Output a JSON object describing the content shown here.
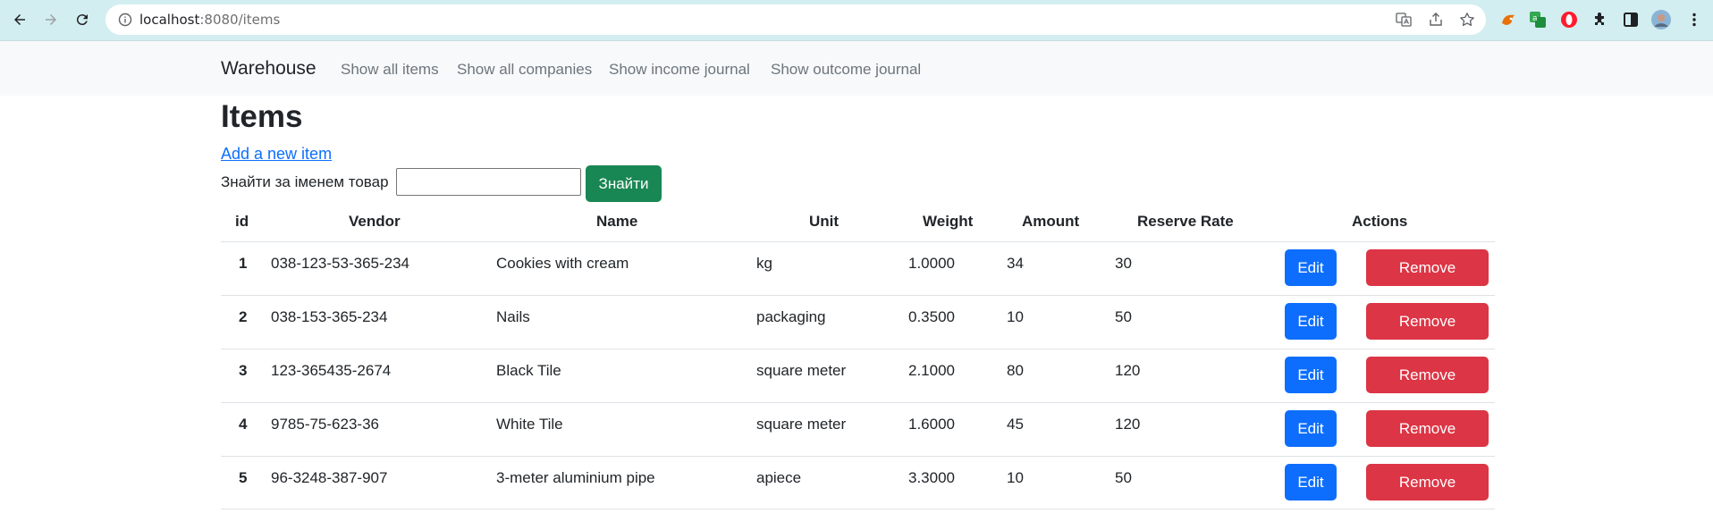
{
  "browser": {
    "url_host": "localhost",
    "url_rest": ":8080/items"
  },
  "navbar": {
    "brand": "Warehouse",
    "links": [
      "Show all items",
      "Show all companies",
      "Show income journal",
      "Show outcome journal"
    ]
  },
  "main": {
    "title": "Items",
    "add_link": "Add a new item",
    "search": {
      "label": "Знайти за іменем товар",
      "value": "",
      "button": "Знайти"
    }
  },
  "table": {
    "headers": [
      "id",
      "Vendor",
      "Name",
      "Unit",
      "Weight",
      "Amount",
      "Reserve Rate",
      "Actions"
    ],
    "rows": [
      {
        "id": "1",
        "vendor": "038-123-53-365-234",
        "name": "Cookies with cream",
        "unit": "kg",
        "weight": "1.0000",
        "amount": "34",
        "reserve": "30"
      },
      {
        "id": "2",
        "vendor": "038-153-365-234",
        "name": "Nails",
        "unit": "packaging",
        "weight": "0.3500",
        "amount": "10",
        "reserve": "50"
      },
      {
        "id": "3",
        "vendor": "123-365435-2674",
        "name": "Black Tile",
        "unit": "square meter",
        "weight": "2.1000",
        "amount": "80",
        "reserve": "120"
      },
      {
        "id": "4",
        "vendor": "9785-75-623-36",
        "name": "White Tile",
        "unit": "square meter",
        "weight": "1.6000",
        "amount": "45",
        "reserve": "120"
      },
      {
        "id": "5",
        "vendor": "96-3248-387-907",
        "name": "3-meter aluminium pipe",
        "unit": "apiece",
        "weight": "3.3000",
        "amount": "10",
        "reserve": "50"
      }
    ],
    "edit_label": "Edit",
    "remove_label": "Remove"
  },
  "colors": {
    "primary": "#0d6efd",
    "danger": "#dc3545",
    "success": "#198754",
    "chrome": "#d3eef0"
  }
}
